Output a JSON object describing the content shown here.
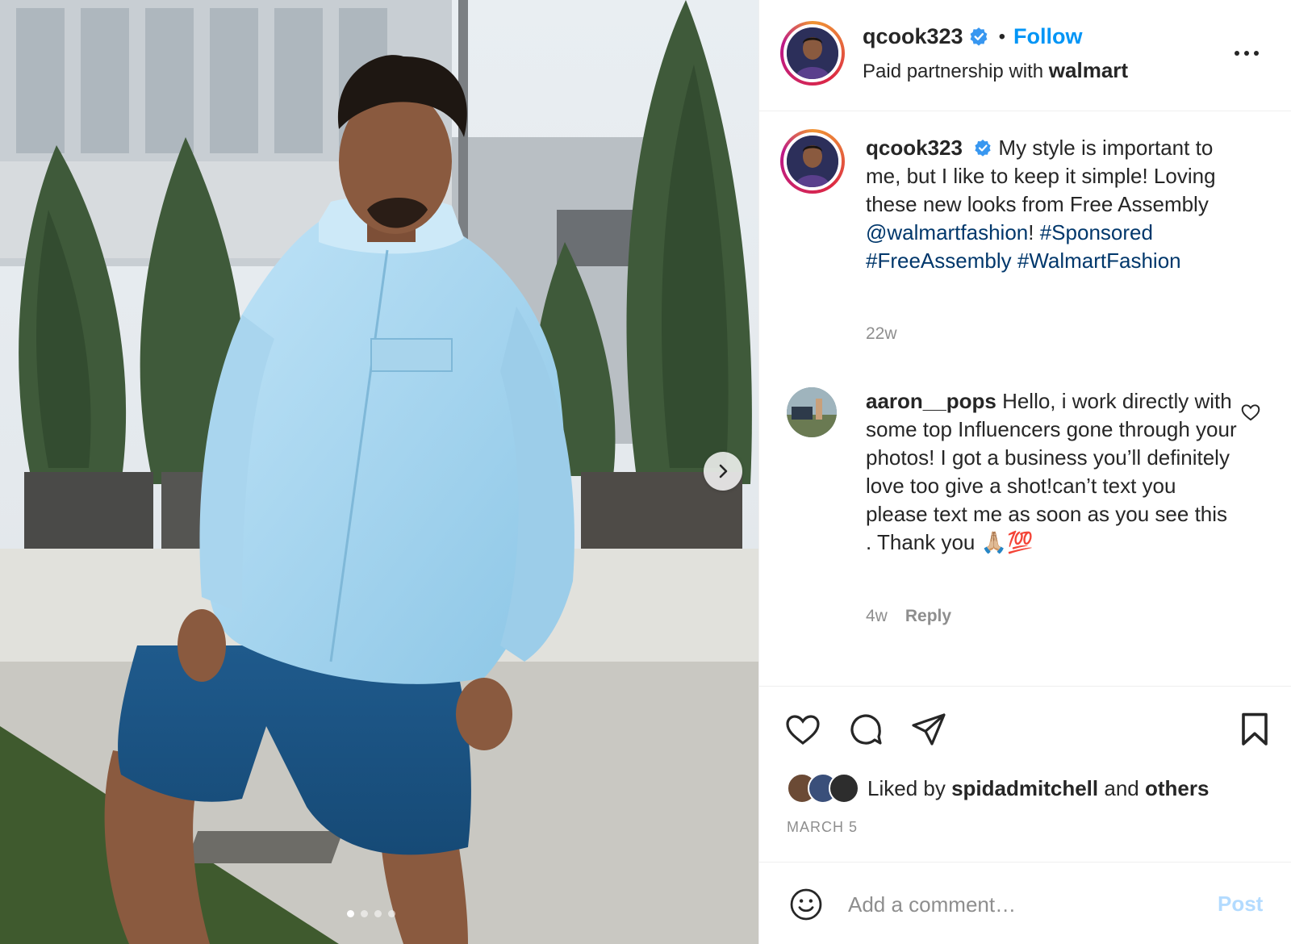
{
  "post": {
    "username": "qcook323",
    "follow_label": "Follow",
    "separator": "•",
    "partnership_prefix": "Paid partnership with",
    "partner": "walmart",
    "caption": {
      "username": "qcook323",
      "text_before": "My style is important to me, but I like to keep it simple! Loving these new looks from Free Assembly",
      "mention": "@walmartfashion",
      "text_after": "!",
      "hashtags": [
        "#Sponsored",
        "#FreeAssembly",
        "#WalmartFashion"
      ],
      "time": "22w"
    },
    "comment": {
      "username": "aaron__pops",
      "text": "Hello, i work directly with some top Influencers gone through your photos! I got a business you’ll definitely love too give a shot!can’t text you please text me as soon as you see this . Thank you 🙏🏼💯",
      "time": "4w",
      "reply_label": "Reply"
    },
    "likes": {
      "prefix": "Liked by",
      "user": "spidadmitchell",
      "and": "and",
      "others": "others"
    },
    "date": "MARCH 5",
    "add_comment": {
      "placeholder": "Add a comment…",
      "post_label": "Post"
    },
    "carousel": {
      "slide_count": 4,
      "active_index": 0
    }
  },
  "colors": {
    "link_blue": "#0095f6",
    "hashtag_blue": "#00376b",
    "muted_gray": "#8e8e8e",
    "post_disabled": "#b3dbff",
    "verified_badge": "#3897f0"
  },
  "icons": [
    "verified-badge-icon",
    "more-options-icon",
    "chevron-right-icon",
    "heart-icon",
    "comment-icon",
    "share-icon",
    "bookmark-icon",
    "emoji-icon"
  ]
}
